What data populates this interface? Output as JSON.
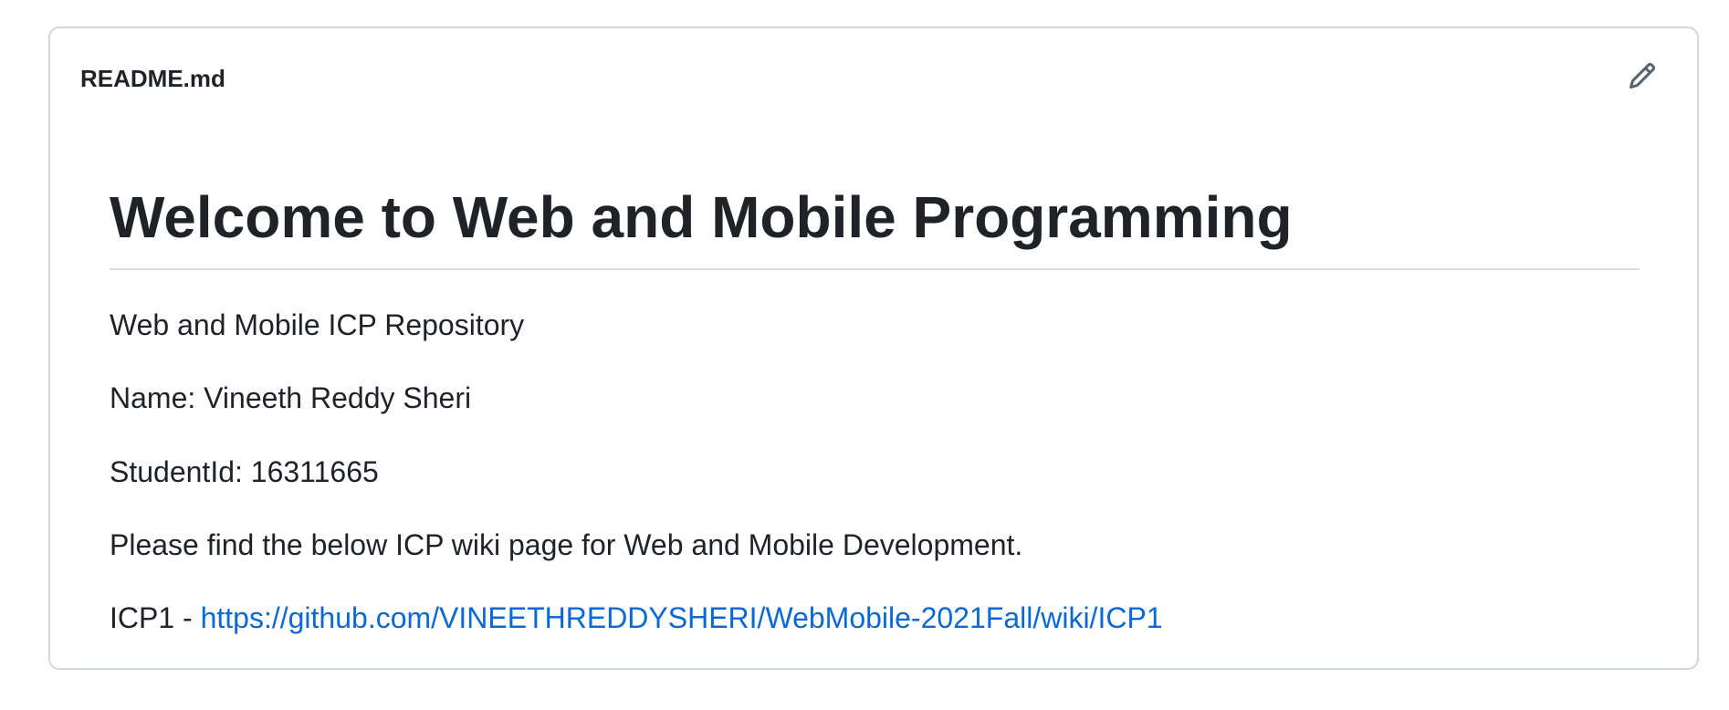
{
  "readme": {
    "file_name": "README.md",
    "edit_icon": "pencil-icon",
    "title": "Welcome to Web and Mobile Programming",
    "paragraphs": {
      "repo": "Web and Mobile ICP Repository",
      "name": "Name: Vineeth Reddy Sheri",
      "student_id": "StudentId: 16311665",
      "instructions": "Please find the below ICP wiki page for Web and Mobile Development."
    },
    "icp1": {
      "prefix": "ICP1 - ",
      "link_text": "https://github.com/VINEETHREDDYSHERI/WebMobile-2021Fall/wiki/ICP1"
    }
  },
  "colors": {
    "text": "#1f2328",
    "link": "#0969da",
    "border": "#d0d7de",
    "icon": "#59636e"
  }
}
